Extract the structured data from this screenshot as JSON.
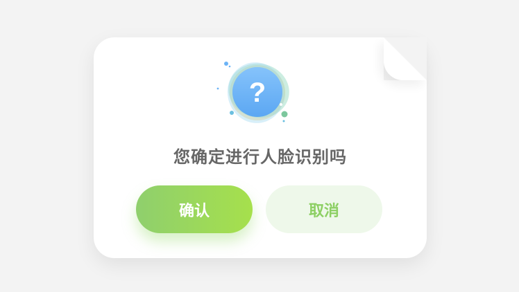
{
  "dialog": {
    "message": "您确定进行人脸识别吗",
    "confirm_label": "确认",
    "cancel_label": "取消",
    "icon": "question-icon",
    "icon_glyph": "?"
  },
  "colors": {
    "background": "#f3f3f3",
    "dialog_bg": "#ffffff",
    "title_text": "#666666",
    "confirm_gradient_start": "#8fcf6d",
    "confirm_gradient_end": "#a6e04c",
    "cancel_bg": "#eef8ea",
    "cancel_text": "#8ccf63",
    "icon_fill": "#6cb3f6"
  }
}
